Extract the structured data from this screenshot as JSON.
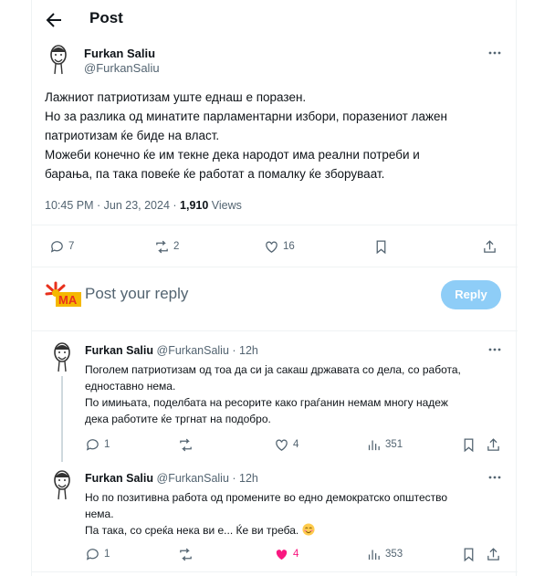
{
  "header": {
    "title": "Post"
  },
  "tweet": {
    "author_name": "Furkan Saliu",
    "author_handle": "@FurkanSaliu",
    "lines": [
      "Лажниот патриотизам уште еднаш е поразен.",
      "Но за разлика од минатите парламентарни избори, поразениот лажен",
      "патриотизам ќе биде на власт.",
      "Можеби конечно ќе им текне дека народот има реални потреби и",
      "барања, па така повеќе ќе работат а помалку ќе зборуваат."
    ],
    "timestamp": "10:45 PM · Jun 23, 2024 · ",
    "views_count": "1,910",
    "views_label": " Views",
    "replies": "7",
    "reposts": "2",
    "likes": "16"
  },
  "composer": {
    "placeholder": "Post your reply",
    "button": "Reply"
  },
  "replies": [
    {
      "author_name": "Furkan Saliu",
      "author_meta": "@FurkanSaliu · 12h",
      "lines": [
        "Поголем патриотизам од тоа да си ја сакаш државата со дела, со работа,",
        "едноставно нема.",
        "По имињата, поделбата на ресорите како граѓанин немам многу надеж",
        "дека работите ќе тргнат на подобро."
      ],
      "replies": "1",
      "reposts": "",
      "likes": "4",
      "views": "351"
    },
    {
      "author_name": "Furkan Saliu",
      "author_meta": "@FurkanSaliu · 12h",
      "lines": [
        "Но по позитивна работа од промените во едно демократско општество",
        "нема.",
        "Па така, со среќа нека ви е... Ќе ви треба. "
      ],
      "replies": "1",
      "reposts": "",
      "likes": "4",
      "views": "353"
    }
  ],
  "colors": {
    "accent": "#1d9bf0",
    "like_active": "#f91880",
    "muted": "#536471"
  }
}
